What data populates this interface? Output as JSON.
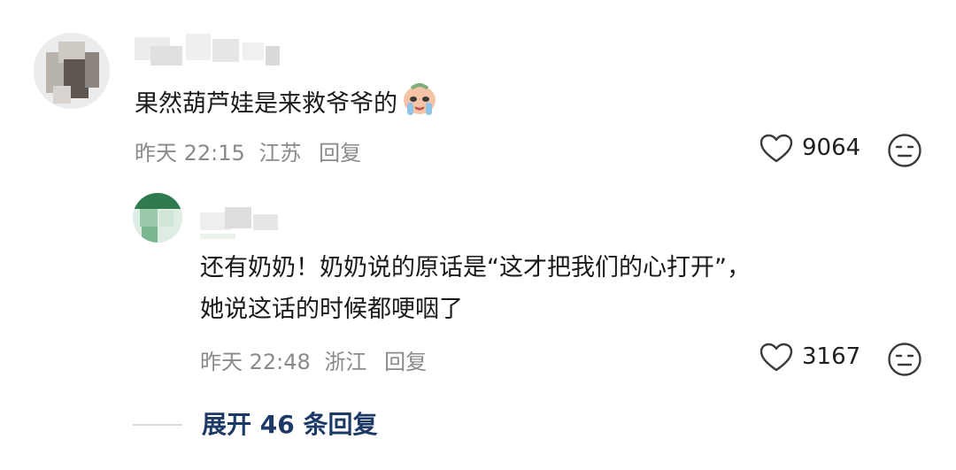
{
  "comment": {
    "text": "果然葫芦娃是来救爷爷的",
    "emoji": "crying-face-sticker",
    "time": "昨天 22:15",
    "location": "江苏",
    "reply_label": "回复",
    "likes": "9064"
  },
  "reply": {
    "line1": "还有奶奶！奶奶说的原话是“这才把我们的心打开”，",
    "line2": "她说这话的时候都哽咽了",
    "time": "昨天 22:48",
    "location": "浙江",
    "reply_label": "回复",
    "likes": "3167"
  },
  "expand": {
    "label": "展开 46 条回复"
  },
  "colors": {
    "accent": "#1d3a66",
    "meta": "#8a8a8a",
    "text": "#1a1a1a"
  }
}
